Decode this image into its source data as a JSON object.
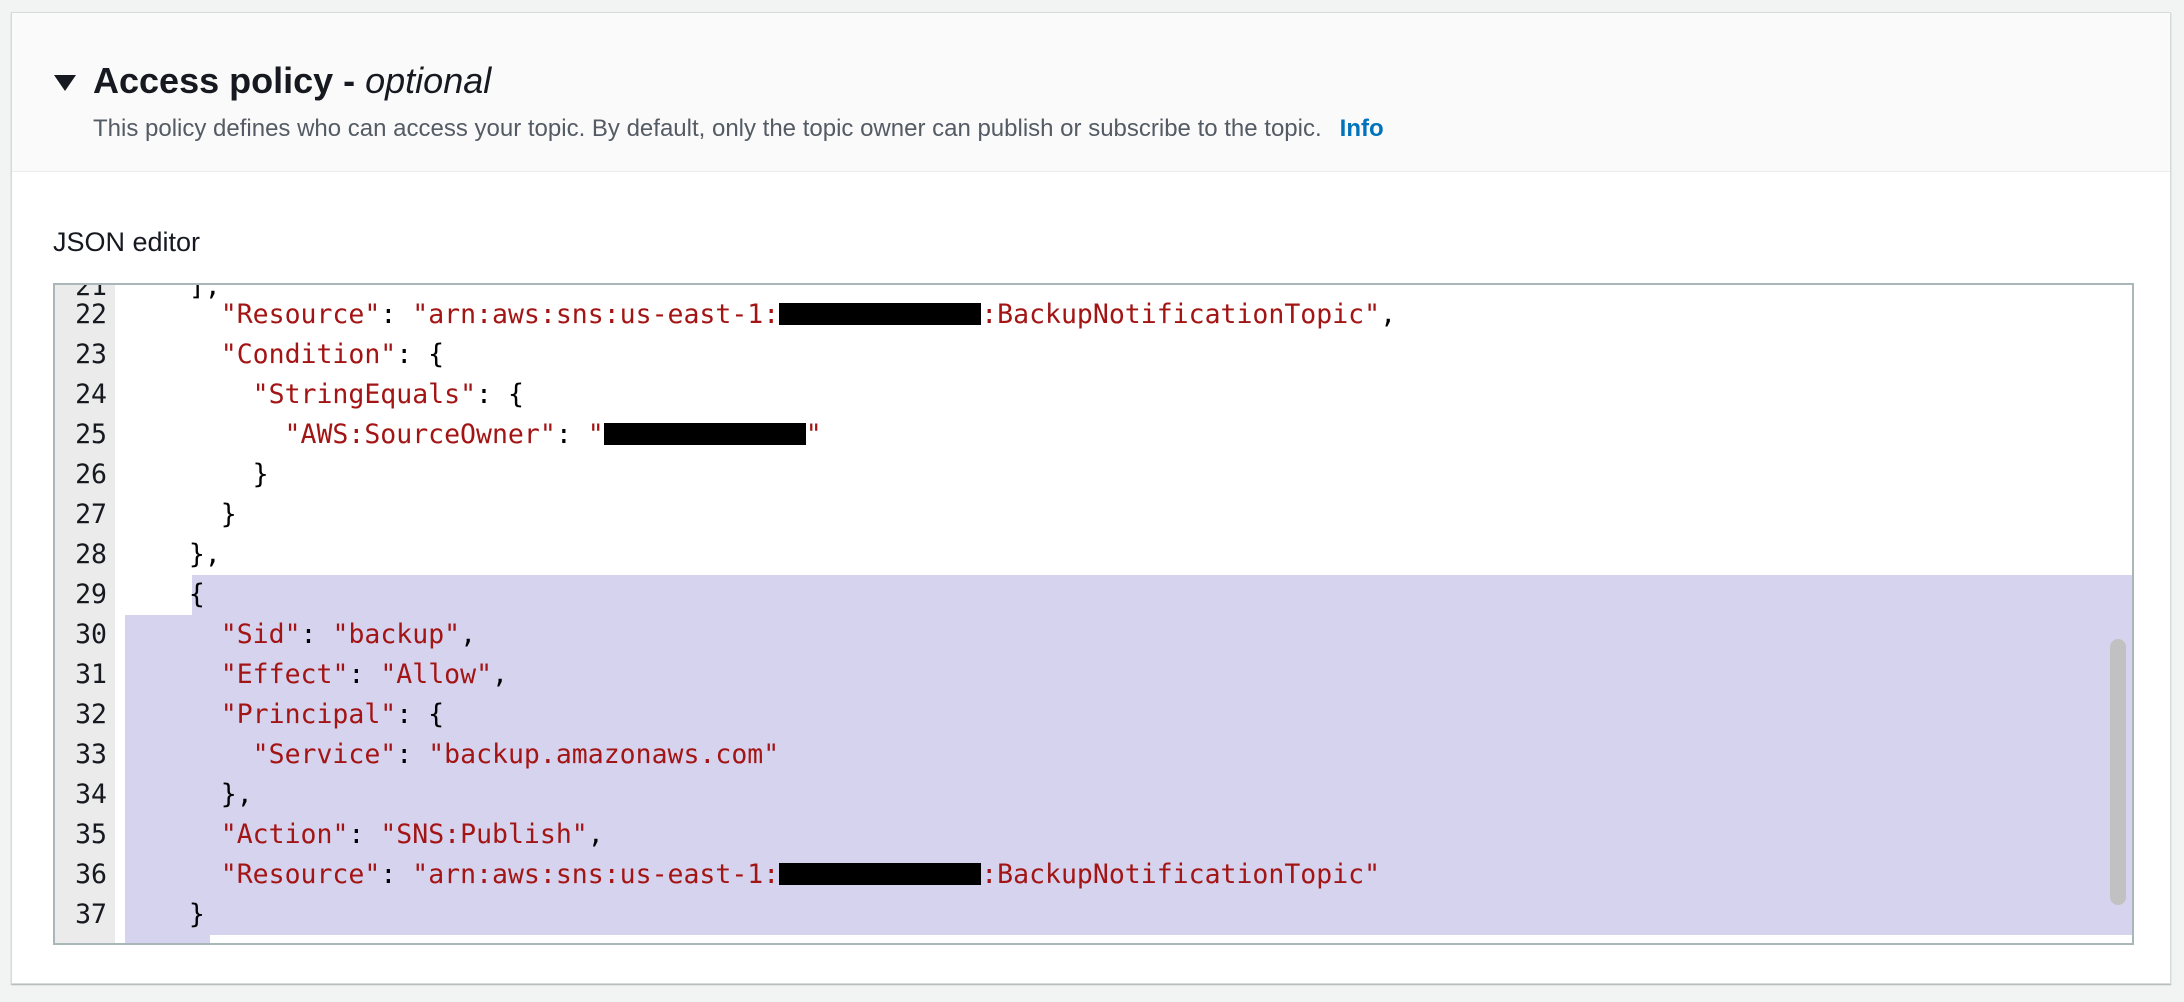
{
  "section": {
    "title": "Access policy - ",
    "title_optional": "optional",
    "description": "This policy defines who can access your topic. By default, only the topic owner can publish or subscribe to the topic.",
    "info_link": "Info"
  },
  "editor": {
    "label": "JSON editor",
    "lines": [
      {
        "num": "21",
        "text": "    ],"
      },
      {
        "num": "22",
        "key": "Resource",
        "prefix": "arn:aws:sns:us-east-1:",
        "suffix": ":BackupNotificationTopic",
        "tail": ","
      },
      {
        "num": "23",
        "key": "Condition"
      },
      {
        "num": "24",
        "key": "StringEquals"
      },
      {
        "num": "25",
        "key": "AWS:SourceOwner"
      },
      {
        "num": "26",
        "text": "}"
      },
      {
        "num": "27",
        "text": "}"
      },
      {
        "num": "28",
        "text": "},"
      },
      {
        "num": "29",
        "text": "{"
      },
      {
        "num": "30",
        "key": "Sid",
        "value": "backup"
      },
      {
        "num": "31",
        "key": "Effect",
        "value": "Allow"
      },
      {
        "num": "32",
        "key": "Principal"
      },
      {
        "num": "33",
        "key": "Service",
        "value": "backup.amazonaws.com"
      },
      {
        "num": "34",
        "text": "},"
      },
      {
        "num": "35",
        "key": "Action",
        "value": "SNS:Publish"
      },
      {
        "num": "36",
        "key": "Resource",
        "prefix": "arn:aws:sns:us-east-1:",
        "suffix": ":BackupNotificationTopic"
      },
      {
        "num": "37",
        "text": "}"
      }
    ]
  }
}
